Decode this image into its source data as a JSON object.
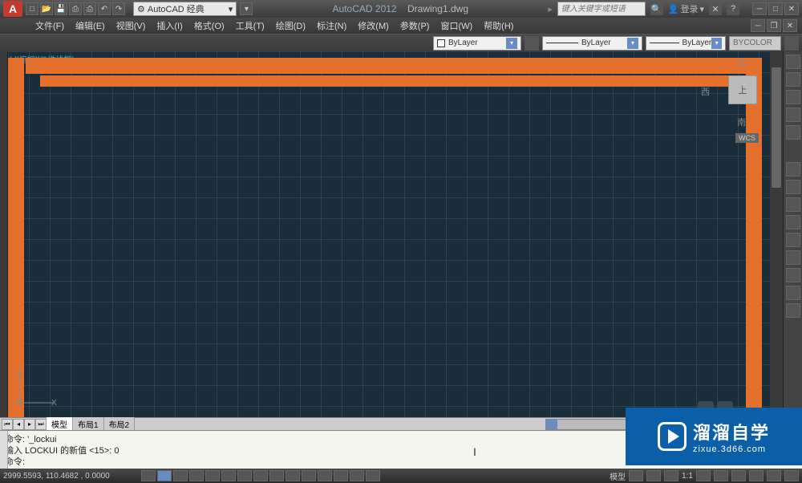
{
  "title": {
    "app_name": "AutoCAD 2012",
    "document": "Drawing1.dwg",
    "workspace": "AutoCAD 经典",
    "search_placeholder": "键入关键字或短语",
    "login": "登录"
  },
  "menus": [
    "文件(F)",
    "编辑(E)",
    "视图(V)",
    "插入(I)",
    "格式(O)",
    "工具(T)",
    "绘图(D)",
    "标注(N)",
    "修改(M)",
    "参数(P)",
    "窗口(W)",
    "帮助(H)"
  ],
  "properties": {
    "color": "ByLayer",
    "linetype": "ByLayer",
    "lineweight": "ByLayer",
    "plotstyle": "BYCOLOR"
  },
  "viewport_label": "[-][俯视][二维线框]",
  "viewcube": {
    "top": "上",
    "n": "北",
    "w": "西",
    "s": "南",
    "wcs": "WCS"
  },
  "ucs": {
    "x": "X",
    "y": "Y"
  },
  "tabs": {
    "model": "模型",
    "layout1": "布局1",
    "layout2": "布局2"
  },
  "command": {
    "line1": "命令: '_lockui",
    "line2": "输入 LOCKUI 的新值 <15>: 0",
    "prompt": "命令:"
  },
  "status": {
    "coords": "2999.5593, 110.4682 , 0.0000",
    "space": "模型",
    "scale": "1:1"
  },
  "watermark": {
    "brand": "溜溜自学",
    "url": "zixue.3d66.com"
  }
}
